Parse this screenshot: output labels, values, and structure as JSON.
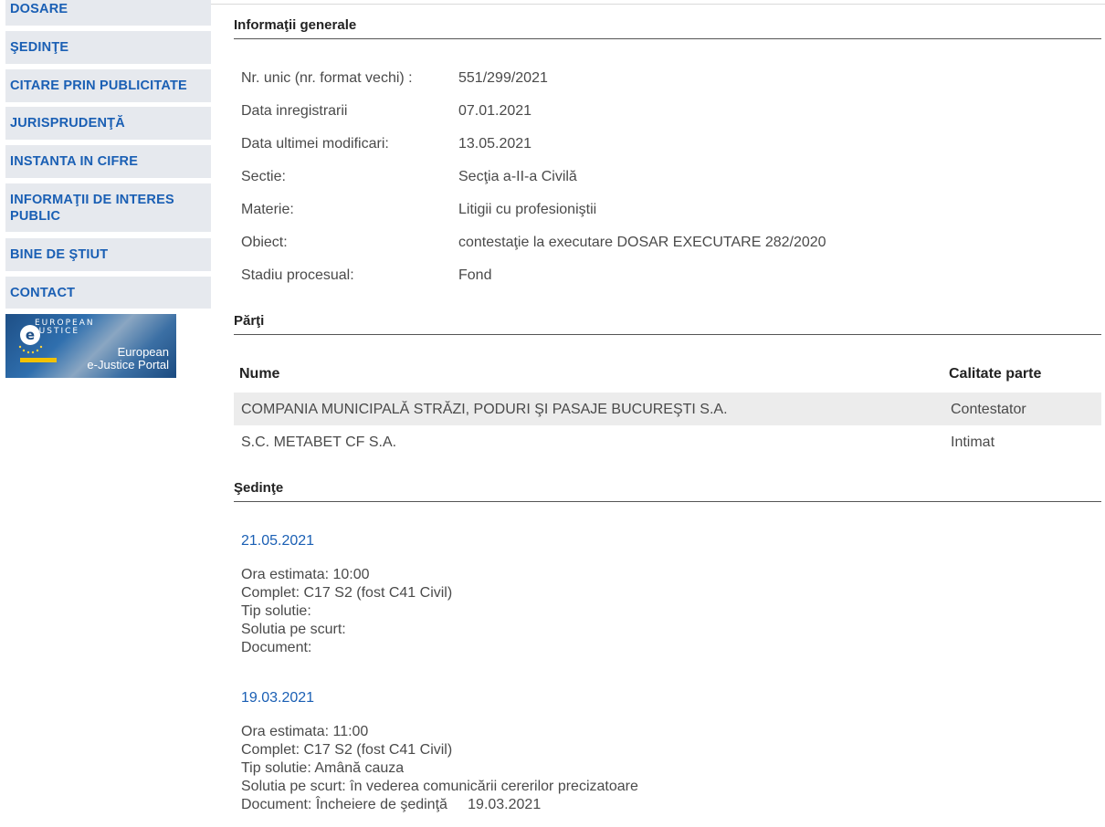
{
  "sidebar": {
    "items": [
      {
        "label": "DOSARE"
      },
      {
        "label": "ŞEDINŢE"
      },
      {
        "label": "CITARE PRIN PUBLICITATE"
      },
      {
        "label": "JURISPRUDENŢĂ"
      },
      {
        "label": "INSTANTA IN CIFRE"
      },
      {
        "label": "INFORMAŢII DE INTERES PUBLIC"
      },
      {
        "label": "BINE DE ŞTIUT"
      },
      {
        "label": "CONTACT"
      }
    ],
    "banner": {
      "badge": "EUROPEAN JUSTICE",
      "line1": "European",
      "line2": "e-Justice Portal"
    }
  },
  "general": {
    "title": "Informaţii generale",
    "fields": [
      {
        "label": "Nr. unic (nr. format vechi) :",
        "value": "551/299/2021"
      },
      {
        "label": "Data inregistrarii",
        "value": "07.01.2021"
      },
      {
        "label": "Data ultimei modificari:",
        "value": "13.05.2021"
      },
      {
        "label": "Sectie:",
        "value": "Secţia a-II-a Civilă"
      },
      {
        "label": "Materie:",
        "value": "Litigii cu profesioniştii"
      },
      {
        "label": "Obiect:",
        "value": "contestaţie la executare DOSAR EXECUTARE 282/2020"
      },
      {
        "label": "Stadiu procesual:",
        "value": "Fond"
      }
    ]
  },
  "parti": {
    "title": "Părţi",
    "headers": {
      "name": "Nume",
      "role": "Calitate parte"
    },
    "rows": [
      {
        "name": "COMPANIA MUNICIPALĂ STRĂZI, PODURI ŞI PASAJE BUCUREŞTI S.A.",
        "role": "Contestator"
      },
      {
        "name": "S.C. METABET CF S.A.",
        "role": "Intimat"
      }
    ]
  },
  "sedinte": {
    "title": "Şedinţe",
    "hearings": [
      {
        "date": "21.05.2021",
        "ora": "Ora estimata: 10:00",
        "complet": "Complet: C17 S2 (fost C41 Civil)",
        "tip": "Tip solutie:",
        "solutia": "Solutia pe scurt:",
        "document": "Document:"
      },
      {
        "date": "19.03.2021",
        "ora": "Ora estimata: 11:00",
        "complet": "Complet: C17 S2 (fost C41 Civil)",
        "tip": "Tip solutie: Amână cauza",
        "solutia": "Solutia pe scurt: în vederea comunicării cererilor precizatoare",
        "document": "Document: Încheiere de şedinţă     19.03.2021"
      }
    ]
  }
}
